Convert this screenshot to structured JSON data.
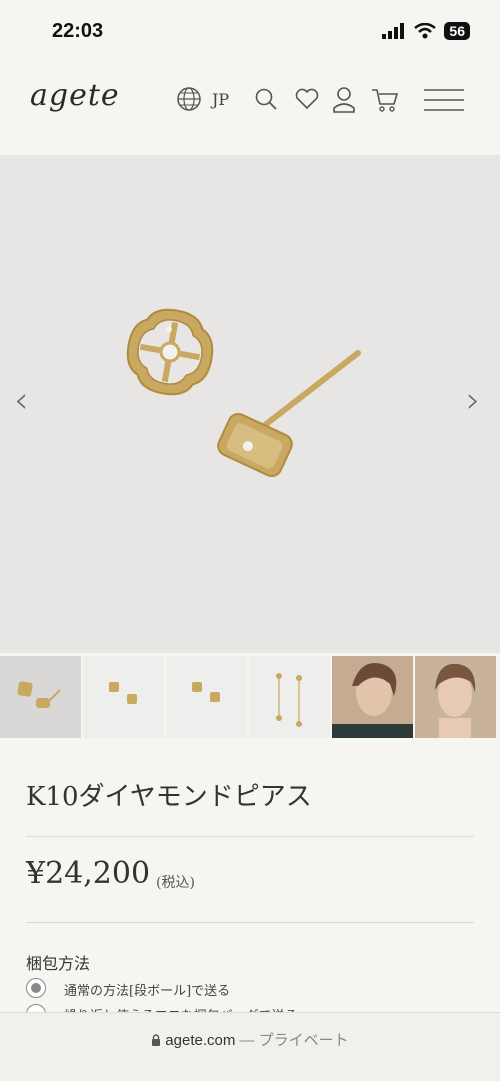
{
  "status_bar": {
    "time": "22:03",
    "battery": "56"
  },
  "header": {
    "logo": "agete",
    "language": "JP"
  },
  "product": {
    "title": "K10ダイヤモンドピアス",
    "price": "¥24,200",
    "tax_note": "(税込)"
  },
  "wrapping": {
    "label": "梱包方法",
    "options": [
      {
        "label": "通常の方法[段ボール]で送る",
        "selected": true
      },
      {
        "label": "繰り返し使えるエコな梱包バッグで送る",
        "selected": false
      }
    ]
  },
  "browser": {
    "domain": "agete.com",
    "mode": "— プライベート"
  }
}
